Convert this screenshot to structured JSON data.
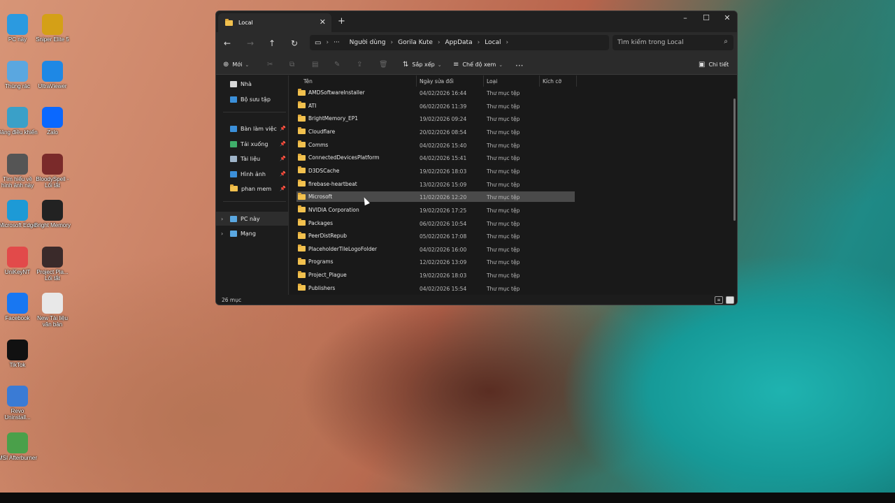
{
  "desktop": {
    "icons": [
      {
        "label": "PC này",
        "icon": "monitor-icon",
        "color": "#2b9ae0"
      },
      {
        "label": "Sniper Elite 5",
        "icon": "game-icon",
        "color": "#d4a017"
      },
      {
        "label": "Thùng rác",
        "icon": "recycle-bin-icon",
        "color": "#5aa7e0"
      },
      {
        "label": "UltraViewer",
        "icon": "remote-icon",
        "color": "#1e88e5"
      },
      {
        "label": "Bảng điều khiển",
        "icon": "control-panel-icon",
        "color": "#3aa0c8"
      },
      {
        "label": "Zalo",
        "icon": "zalo-icon",
        "color": "#0a68ff"
      },
      {
        "label": "Tìm hiểu về hình ảnh này",
        "icon": "spotlight-icon",
        "color": "#555555"
      },
      {
        "label": "BloodySpell - Lối tắt",
        "icon": "game-icon",
        "color": "#7a2a2a"
      },
      {
        "label": "Microsoft Edge",
        "icon": "edge-icon",
        "color": "#1d9ad6"
      },
      {
        "label": "Bright Memory",
        "icon": "game-icon",
        "color": "#222222"
      },
      {
        "label": "UniKeyNT",
        "icon": "unikey-icon",
        "color": "#e24a4a"
      },
      {
        "label": "Project Pla... Lối tắt",
        "icon": "game-icon",
        "color": "#3a2a2a"
      },
      {
        "label": "Facebook",
        "icon": "facebook-icon",
        "color": "#1877f2"
      },
      {
        "label": "New Tài liệu văn bản",
        "icon": "text-file-icon",
        "color": "#e8e8e8"
      },
      {
        "label": "TikTok",
        "icon": "tiktok-icon",
        "color": "#111111"
      },
      {
        "label": "Revo Uninstall...",
        "icon": "revo-icon",
        "color": "#3a7bd5"
      },
      {
        "label": "MSI Afterburner",
        "icon": "afterburner-icon",
        "color": "#4aa04a"
      }
    ]
  },
  "explorer": {
    "tab_title": "Local",
    "breadcrumb": [
      "Người dùng",
      "Gorila Kute",
      "AppData",
      "Local"
    ],
    "search_placeholder": "Tìm kiếm trong Local",
    "commands": {
      "new": "Mới",
      "sort": "Sắp xếp",
      "view": "Chế độ xem",
      "details": "Chi tiết"
    },
    "sidebar": {
      "home": "Nhà",
      "gallery": "Bộ sưu tập",
      "desktop": "Bàn làm việc",
      "downloads": "Tải xuống",
      "documents": "Tài liệu",
      "pictures": "Hình ảnh",
      "phan_mem": "phan mem",
      "this_pc": "PC này",
      "network": "Mạng"
    },
    "columns": {
      "name": "Tên",
      "date": "Ngày sửa đổi",
      "type": "Loại",
      "size": "Kích cỡ"
    },
    "files": [
      {
        "name": "AMDSoftwareInstaller",
        "date": "04/02/2026 16:44",
        "type": "Thư mục tệp"
      },
      {
        "name": "ATI",
        "date": "06/02/2026 11:39",
        "type": "Thư mục tệp"
      },
      {
        "name": "BrightMemory_EP1",
        "date": "19/02/2026 09:24",
        "type": "Thư mục tệp"
      },
      {
        "name": "Cloudflare",
        "date": "20/02/2026 08:54",
        "type": "Thư mục tệp"
      },
      {
        "name": "Comms",
        "date": "04/02/2026 15:40",
        "type": "Thư mục tệp"
      },
      {
        "name": "ConnectedDevicesPlatform",
        "date": "04/02/2026 15:41",
        "type": "Thư mục tệp"
      },
      {
        "name": "D3DSCache",
        "date": "19/02/2026 18:03",
        "type": "Thư mục tệp"
      },
      {
        "name": "firebase-heartbeat",
        "date": "13/02/2026 15:09",
        "type": "Thư mục tệp"
      },
      {
        "name": "Microsoft",
        "date": "11/02/2026 12:20",
        "type": "Thư mục tệp"
      },
      {
        "name": "NVIDIA Corporation",
        "date": "19/02/2026 17:25",
        "type": "Thư mục tệp"
      },
      {
        "name": "Packages",
        "date": "06/02/2026 10:54",
        "type": "Thư mục tệp"
      },
      {
        "name": "PeerDistRepub",
        "date": "05/02/2026 17:08",
        "type": "Thư mục tệp"
      },
      {
        "name": "PlaceholderTileLogoFolder",
        "date": "04/02/2026 16:00",
        "type": "Thư mục tệp"
      },
      {
        "name": "Programs",
        "date": "12/02/2026 13:09",
        "type": "Thư mục tệp"
      },
      {
        "name": "Project_Plague",
        "date": "19/02/2026 18:03",
        "type": "Thư mục tệp"
      },
      {
        "name": "Publishers",
        "date": "04/02/2026 15:54",
        "type": "Thư mục tệp"
      }
    ],
    "selected_file": "Microsoft",
    "status_count": "26 mục",
    "accent": "#f2c14e"
  }
}
